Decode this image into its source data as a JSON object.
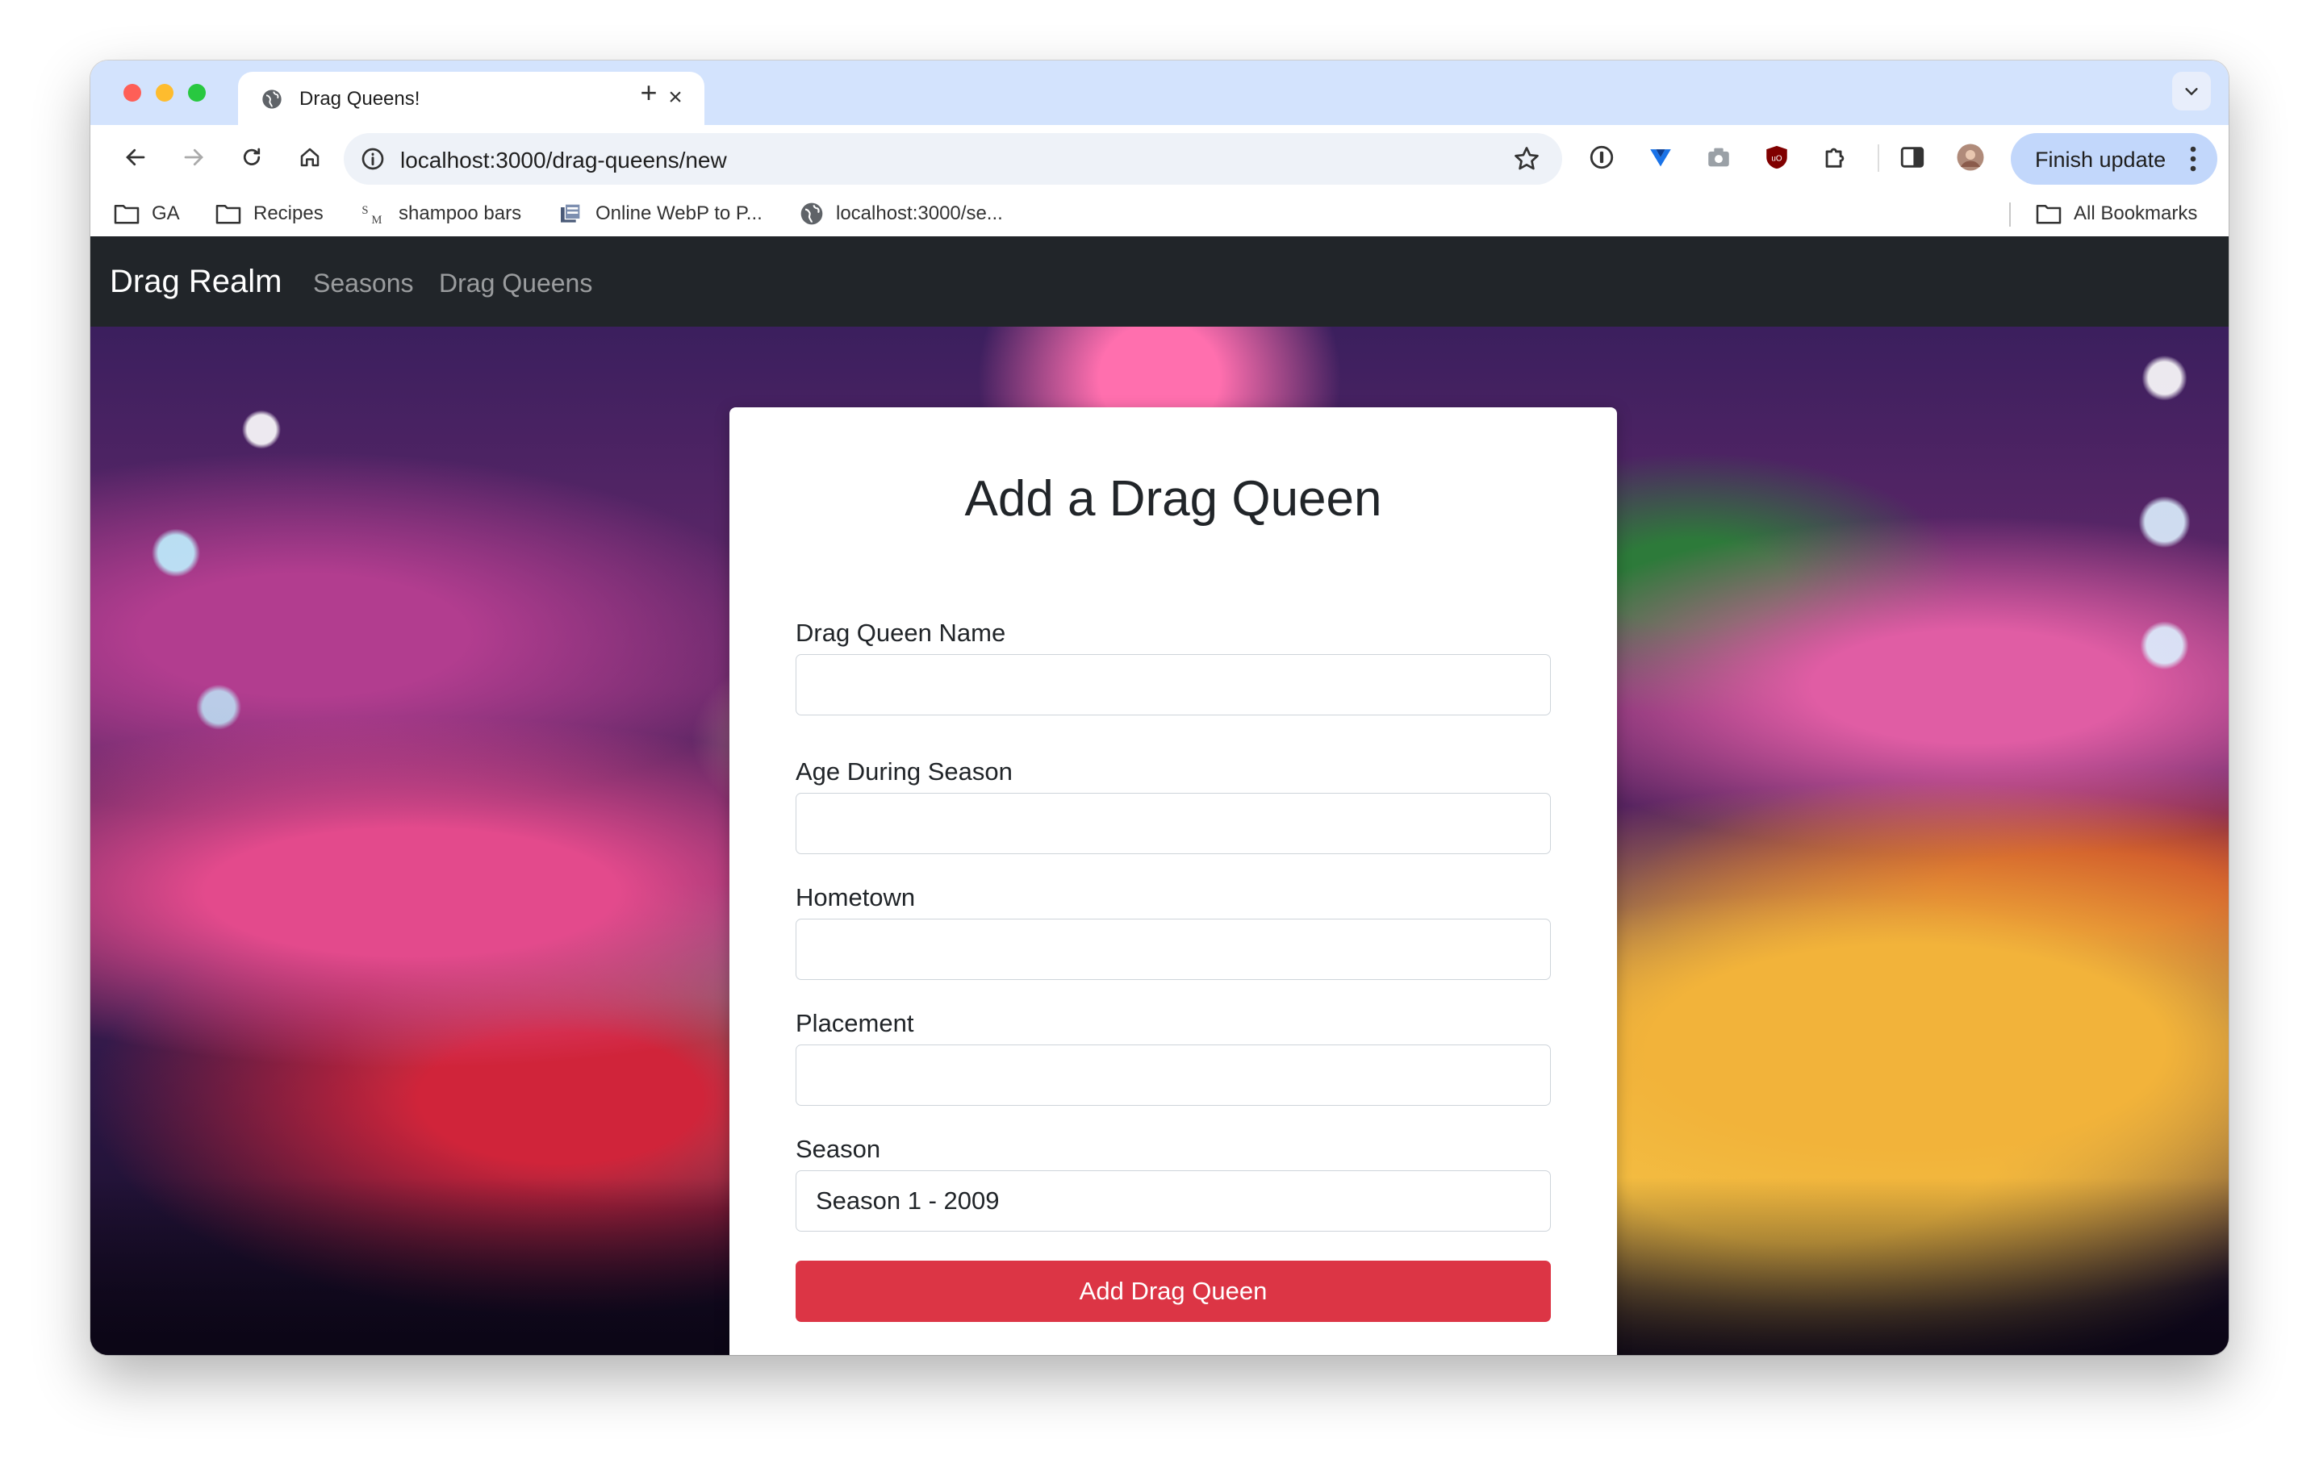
{
  "browser": {
    "tab_title": "Drag Queens!",
    "url": "localhost:3000/drag-queens/new",
    "finish_update_label": "Finish update"
  },
  "bookmarks": {
    "items": [
      {
        "label": "GA",
        "icon": "folder-icon"
      },
      {
        "label": "Recipes",
        "icon": "folder-icon"
      },
      {
        "label": "shampoo bars",
        "icon": "sm-favicon"
      },
      {
        "label": "Online WebP to P...",
        "icon": "converter-favicon"
      },
      {
        "label": "localhost:3000/se...",
        "icon": "globe-icon"
      }
    ],
    "all_bookmarks": "All Bookmarks"
  },
  "app": {
    "brand": "Drag Realm",
    "nav": [
      "Seasons",
      "Drag Queens"
    ]
  },
  "form": {
    "heading": "Add a Drag Queen",
    "fields": [
      {
        "label": "Drag Queen Name",
        "value": ""
      },
      {
        "label": "Age During Season",
        "value": ""
      },
      {
        "label": "Hometown",
        "value": ""
      },
      {
        "label": "Placement",
        "value": ""
      }
    ],
    "season": {
      "label": "Season",
      "selected": "Season 1 - 2009"
    },
    "submit_label": "Add Drag Queen"
  },
  "colors": {
    "navbar": "#212529",
    "submit_button": "#dc3545",
    "tabstrip": "#d3e3fd"
  }
}
